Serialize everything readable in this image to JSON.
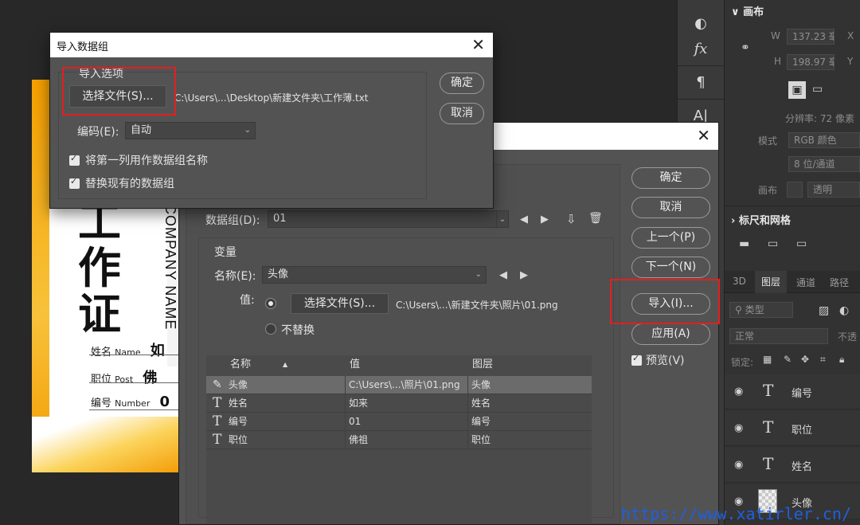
{
  "canvas_card": {
    "title_chars": [
      "工",
      "作",
      "证"
    ],
    "company": "COMPANY NAME",
    "fields": [
      {
        "label": "姓名",
        "label_en": "Name",
        "value": "如"
      },
      {
        "label": "职位",
        "label_en": "Post",
        "value": "佛"
      },
      {
        "label": "编号",
        "label_en": "Number",
        "value": "0"
      }
    ]
  },
  "right_panel": {
    "canvas_title": "画布",
    "w_label": "W",
    "w_value": "137.23 毫",
    "h_label": "H",
    "h_value": "198.97 毫",
    "x_label": "X",
    "y_label": "Y",
    "resolution": "分辨率: 72 像素",
    "mode_label": "模式",
    "mode_value": "RGB 颜色",
    "depth_value": "8 位/通道",
    "fill_label": "画布",
    "fill_value": "透明",
    "rulers_title": "标尺和网格",
    "tabs": [
      "3D",
      "图层",
      "通道",
      "路径"
    ],
    "search_placeholder": "类型",
    "blend_mode": "正常",
    "opacity_label": "不透",
    "lock_label": "锁定:",
    "layers": [
      {
        "type": "text",
        "name": "编号"
      },
      {
        "type": "text",
        "name": "职位"
      },
      {
        "type": "text",
        "name": "姓名"
      },
      {
        "type": "image",
        "name": "头像"
      }
    ]
  },
  "variables_dialog": {
    "dataset_label": "数据组(D):",
    "dataset_value": "01",
    "variables_group": "变量",
    "name_label": "名称(E):",
    "name_value": "头像",
    "value_label": "值:",
    "choose_file_label": "选择文件(S)...",
    "file_path": "C:\\Users\\...\\新建文件夹\\照片\\01.png",
    "no_replace_label": "不替换",
    "table": {
      "headers": [
        "名称",
        "值",
        "图层"
      ],
      "rows": [
        {
          "name": "头像",
          "value": "C:\\Users\\...\\照片\\01.png",
          "layer": "头像",
          "icon": "image"
        },
        {
          "name": "姓名",
          "value": "如来",
          "layer": "姓名",
          "icon": "T"
        },
        {
          "name": "编号",
          "value": "01",
          "layer": "编号",
          "icon": "T"
        },
        {
          "name": "职位",
          "value": "佛祖",
          "layer": "职位",
          "icon": "T"
        }
      ]
    },
    "buttons": {
      "ok": "确定",
      "cancel": "取消",
      "prev": "上一个(P)",
      "next": "下一个(N)",
      "import": "导入(I)...",
      "apply": "应用(A)",
      "preview": "预览(V)"
    }
  },
  "import_dialog": {
    "title": "导入数据组",
    "group_label": "导入选项",
    "choose_file_label": "选择文件(S)...",
    "file_path": "C:\\Users\\...\\Desktop\\新建文件夹\\工作薄.txt",
    "encoding_label": "编码(E):",
    "encoding_value": "自动",
    "checkbox_first_column": "将第一列用作数据组名称",
    "checkbox_replace": "替换现有的数据组",
    "ok": "确定",
    "cancel": "取消"
  },
  "watermark": "https://www.xatirler.cn/",
  "colors": {
    "highlight_red": "#e31f1f",
    "dialog_bg": "#535353",
    "watermark": "#1e5fe0"
  }
}
